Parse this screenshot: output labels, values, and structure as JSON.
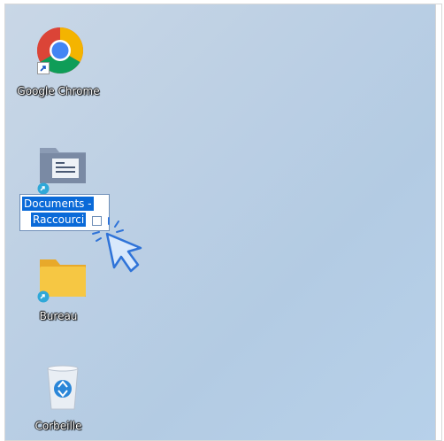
{
  "desktop": {
    "icons": [
      {
        "label": "Google Chrome",
        "icon": "chrome-icon",
        "shortcut": true
      },
      {
        "label_line1": "Documents -",
        "label_line2": "Raccourci",
        "icon": "documents-folder-icon",
        "shortcut": true,
        "selected": true,
        "renaming": true
      },
      {
        "label": "Bureau",
        "icon": "folder-icon",
        "shortcut": true
      },
      {
        "label": "Corbeille",
        "icon": "recycle-bin-icon",
        "shortcut": false
      }
    ]
  },
  "colors": {
    "selection": "#0a6ad8",
    "desktop_background": "#bdd0e4",
    "cursor_accent": "#2f73d8",
    "folder_yellow": "#f6c743"
  },
  "cursor": {
    "icon": "pointer-cursor-icon"
  }
}
